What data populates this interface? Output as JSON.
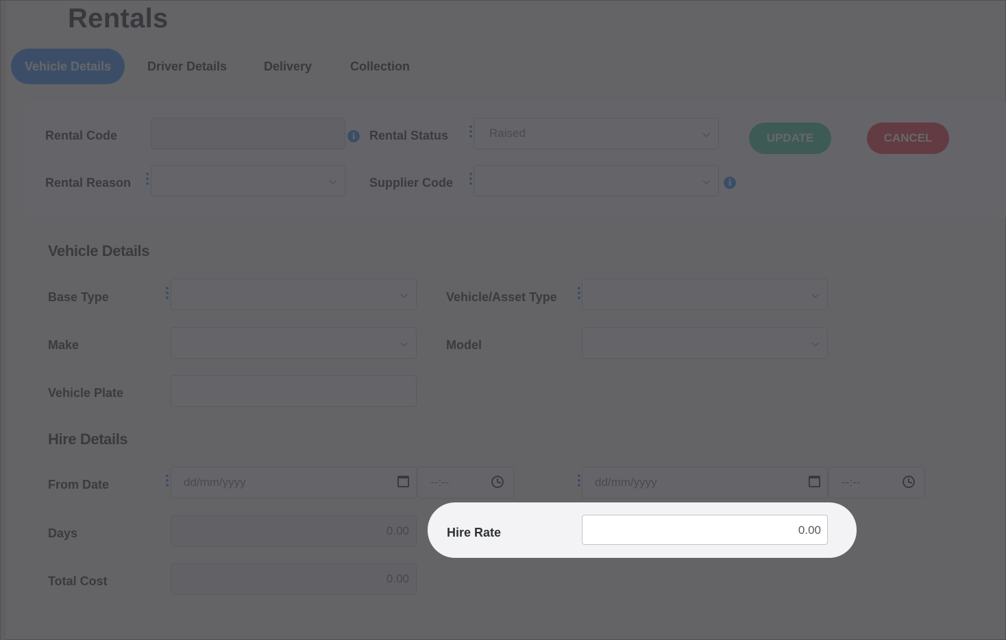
{
  "page": {
    "title": "Rentals"
  },
  "tabs": [
    {
      "label": "Vehicle Details",
      "active": true
    },
    {
      "label": "Driver Details",
      "active": false
    },
    {
      "label": "Delivery",
      "active": false
    },
    {
      "label": "Collection",
      "active": false
    }
  ],
  "header_form": {
    "rental_code_label": "Rental Code",
    "rental_code_value": "",
    "rental_status_label": "Rental Status",
    "rental_status_value": "Raised",
    "rental_reason_label": "Rental Reason",
    "rental_reason_value": "",
    "supplier_code_label": "Supplier Code",
    "supplier_code_value": "",
    "update_label": "UPDATE",
    "cancel_label": "CANCEL"
  },
  "vehicle_details": {
    "section_title": "Vehicle Details",
    "base_type_label": "Base Type",
    "vehicle_asset_type_label": "Vehicle/Asset Type",
    "make_label": "Make",
    "model_label": "Model",
    "vehicle_plate_label": "Vehicle Plate"
  },
  "hire_details": {
    "section_title": "Hire Details",
    "from_date_label": "From Date",
    "date_placeholder": "dd/mm/yyyy",
    "time_placeholder": "--:--",
    "days_label": "Days",
    "days_value": "0.00",
    "hire_rate_label": "Hire Rate",
    "hire_rate_value": "0.00",
    "total_cost_label": "Total Cost",
    "total_cost_value": "0.00"
  },
  "colors": {
    "accent": "#3e8ef0",
    "update": "#45c59a",
    "cancel": "#e83a4f",
    "overlay": "rgba(60,60,64,0.78)"
  },
  "icons": [
    "info-icon",
    "kebab-icon",
    "chevron-down-icon",
    "calendar-icon",
    "clock-icon"
  ]
}
